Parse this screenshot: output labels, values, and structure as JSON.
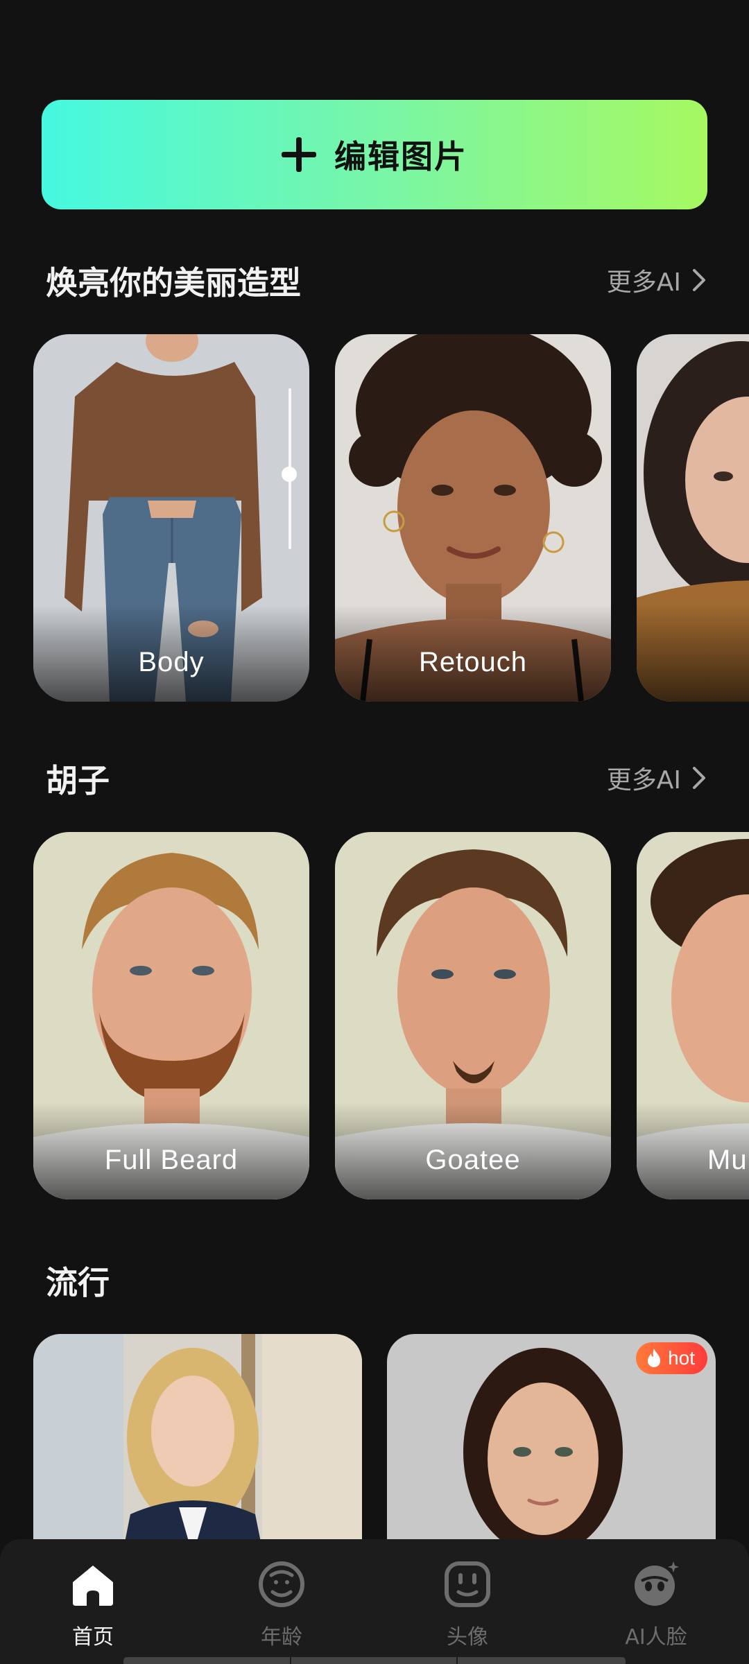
{
  "edit_button": {
    "label": "编辑图片",
    "icon": "plus-icon"
  },
  "sections": [
    {
      "title": "焕亮你的美丽造型",
      "more": "更多AI",
      "cards": [
        "Body",
        "Retouch",
        ""
      ]
    },
    {
      "title": "胡子",
      "more": "更多AI",
      "cards": [
        "Full Beard",
        "Goatee",
        "Mu"
      ]
    },
    {
      "title": "流行"
    }
  ],
  "trending": {
    "badge": "hot",
    "badge_icon": "flame-icon"
  },
  "nav": [
    {
      "label": "首页",
      "icon": "home-icon",
      "active": true
    },
    {
      "label": "年龄",
      "icon": "age-face-icon",
      "active": false
    },
    {
      "label": "头像",
      "icon": "avatar-face-icon",
      "active": false
    },
    {
      "label": "AI人脸",
      "icon": "ai-face-icon",
      "active": false
    }
  ],
  "colors": {
    "accent_start": "#46f8e0",
    "accent_end": "#a6f860",
    "hot": "#ff4a3a",
    "background": "#121212"
  }
}
